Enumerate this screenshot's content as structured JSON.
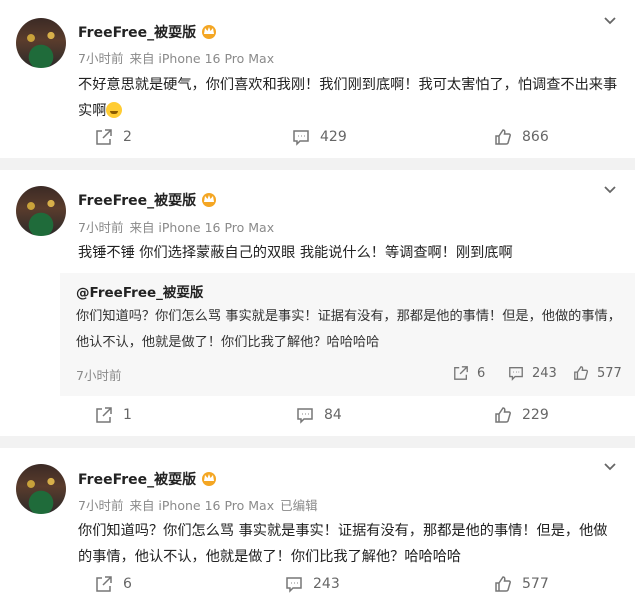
{
  "posts": [
    {
      "username": "FreeFree_被耍版",
      "time": "7小时前",
      "source": "来自 iPhone 16 Pro Max",
      "edited": "",
      "text": "不好意思就是硬气，你们喜欢和我刚！我们刚到底啊！我可太害怕了，怕调查不出来事实啊",
      "emoji": "crying-face",
      "shares": "2",
      "comments": "429",
      "likes": "866"
    },
    {
      "username": "FreeFree_被耍版",
      "time": "7小时前",
      "source": "来自 iPhone 16 Pro Max",
      "edited": "",
      "text": "我锤不锤 你们选择蒙蔽自己的双眼 我能说什么！等调查啊！刚到底啊",
      "quote": {
        "mention": "@FreeFree_被耍版",
        "text": "你们知道吗？你们怎么骂 事实就是事实！证据有没有，那都是他的事情！但是，他做的事情，他认不认，他就是做了！你们比我了解他？哈哈哈哈",
        "time": "7小时前",
        "shares": "6",
        "comments": "243",
        "likes": "577"
      },
      "shares": "1",
      "comments": "84",
      "likes": "229"
    },
    {
      "username": "FreeFree_被耍版",
      "time": "7小时前",
      "source": "来自 iPhone 16 Pro Max",
      "edited": "已编辑",
      "text": "你们知道吗？你们怎么骂 事实就是事实！证据有没有，那都是他的事情！但是，他做的事情，他认不认，他就是做了！你们比我了解他？哈哈哈哈",
      "shares": "6",
      "comments": "243",
      "likes": "577"
    }
  ],
  "icons": {
    "share": "share-icon",
    "comment": "comment-icon",
    "like": "thumbs-up-icon",
    "more": "chevron-down-icon",
    "badge": "crown-badge-icon"
  },
  "colors": {
    "page_bg": "#f2f2f2",
    "card_bg": "#ffffff",
    "quote_bg": "#f7f7f7",
    "meta": "#8a8a8a",
    "badge": "#f4a623"
  }
}
